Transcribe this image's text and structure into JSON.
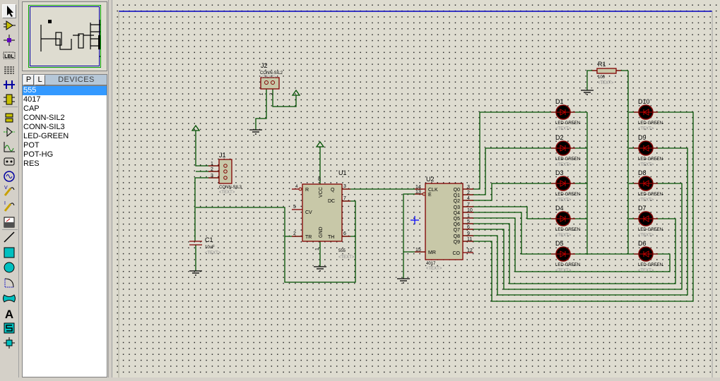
{
  "toolbar": {
    "tools": [
      "selection-mode",
      "component-mode",
      "junction-dot",
      "wire-label",
      "text-script",
      "buses",
      "subcircuit",
      "terminals",
      "device-pins",
      "graph",
      "tape-recorder",
      "generator",
      "voltage-probe",
      "current-probe",
      "virtual-instruments",
      "line",
      "box",
      "circle",
      "arc",
      "path",
      "text",
      "symbol",
      "marker"
    ],
    "text_tool_glyph": "A",
    "label_tool_glyph": "LBL"
  },
  "panel": {
    "p_button": "P",
    "l_button": "L",
    "title": "DEVICES",
    "devices": [
      "555",
      "4017",
      "CAP",
      "CONN-SIL2",
      "CONN-SIL3",
      "LED-GREEN",
      "POT",
      "POT-HG",
      "RES"
    ],
    "selected": "555"
  },
  "colors": {
    "wire": "#005000",
    "component_outline": "#800000",
    "component_fill": "#c8c8a8",
    "selection": "#3399ff",
    "sheet_border": "#0000c0"
  },
  "schematic": {
    "placeholder": "<TEXT>",
    "J2": {
      "ref": "J2",
      "value": "CONN-SIL2",
      "pins": [
        "1",
        "2"
      ]
    },
    "J1": {
      "ref": "J1",
      "value": "CONN-SIL3",
      "pins": [
        "1",
        "2",
        "3"
      ]
    },
    "C1": {
      "ref": "C1",
      "value": "10uF"
    },
    "U1": {
      "ref": "U1",
      "value": "555",
      "pin_names": {
        "R": "R",
        "VCC": "VCC",
        "Q": "Q",
        "DC": "DC",
        "CV": "CV",
        "TR": "TR",
        "GND": "GND",
        "TH": "TH"
      },
      "pin_numbers": {
        "R": "4",
        "VCC": "8",
        "Q": "3",
        "DC": "7",
        "CV": "5",
        "TR": "2",
        "GND": "1",
        "TH": "6"
      }
    },
    "U2": {
      "ref": "U2",
      "value": "4017",
      "in_names": [
        "CLK",
        "E",
        "MR"
      ],
      "in_numbers": [
        "14",
        "13",
        "15"
      ],
      "out_names": [
        "Q0",
        "Q1",
        "Q2",
        "Q3",
        "Q4",
        "Q5",
        "Q6",
        "Q7",
        "Q8",
        "Q9"
      ],
      "out_numbers": [
        "3",
        "2",
        "4",
        "7",
        "10",
        "1",
        "5",
        "6",
        "9",
        "11"
      ],
      "co_name": "CO",
      "co_number": "12"
    },
    "R1": {
      "ref": "R1",
      "value": "100"
    },
    "leds": [
      {
        "ref": "D1",
        "value": "LED-GREEN"
      },
      {
        "ref": "D2",
        "value": "LED-GREEN"
      },
      {
        "ref": "D3",
        "value": "LED-GREEN"
      },
      {
        "ref": "D4",
        "value": "LED-GREEN"
      },
      {
        "ref": "D5",
        "value": "LED-GREEN"
      },
      {
        "ref": "D6",
        "value": "LED-GREEN"
      },
      {
        "ref": "D7",
        "value": "LED-GREEN"
      },
      {
        "ref": "D8",
        "value": "LED-GREEN"
      },
      {
        "ref": "D9",
        "value": "LED-GREEN"
      },
      {
        "ref": "D10",
        "value": "LED-GREEN"
      }
    ]
  }
}
